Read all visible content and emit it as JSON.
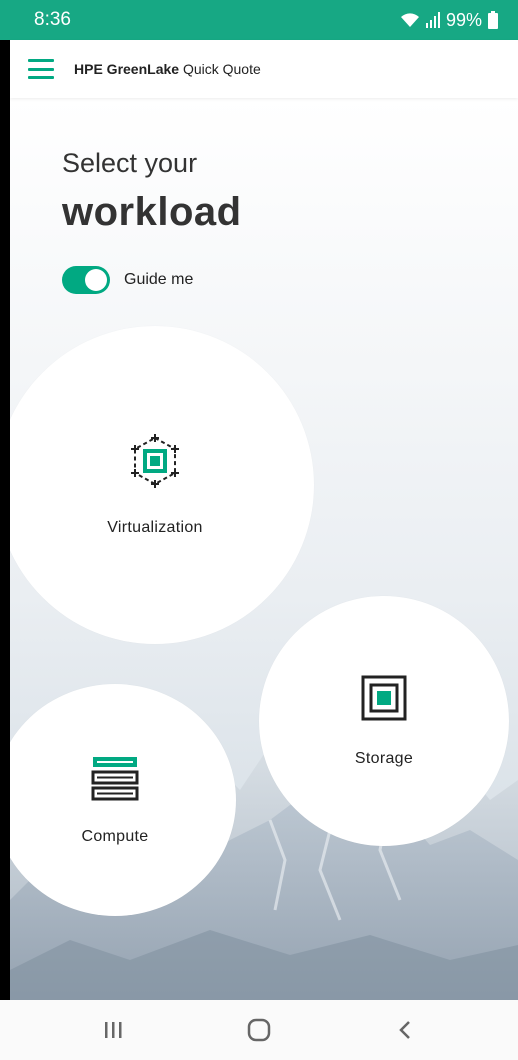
{
  "status_bar": {
    "time": "8:36",
    "battery": "99%",
    "icons": [
      "wifi-icon",
      "signal-icon",
      "battery-icon"
    ]
  },
  "app_bar": {
    "brand": "HPE GreenLake",
    "product": "Quick Quote"
  },
  "heading": {
    "line1": "Select your",
    "line2": "workload"
  },
  "guide_toggle": {
    "label": "Guide me",
    "on": true
  },
  "workloads": {
    "virtualization": {
      "label": "Virtualization",
      "icon": "virtualization-icon"
    },
    "storage": {
      "label": "Storage",
      "icon": "storage-icon"
    },
    "compute": {
      "label": "Compute",
      "icon": "compute-icon"
    }
  },
  "nav_bar": {
    "buttons": [
      "recents-icon",
      "home-icon",
      "back-icon"
    ]
  },
  "colors": {
    "status_bar": "#17a884",
    "accent": "#01a982",
    "text": "#333333"
  }
}
